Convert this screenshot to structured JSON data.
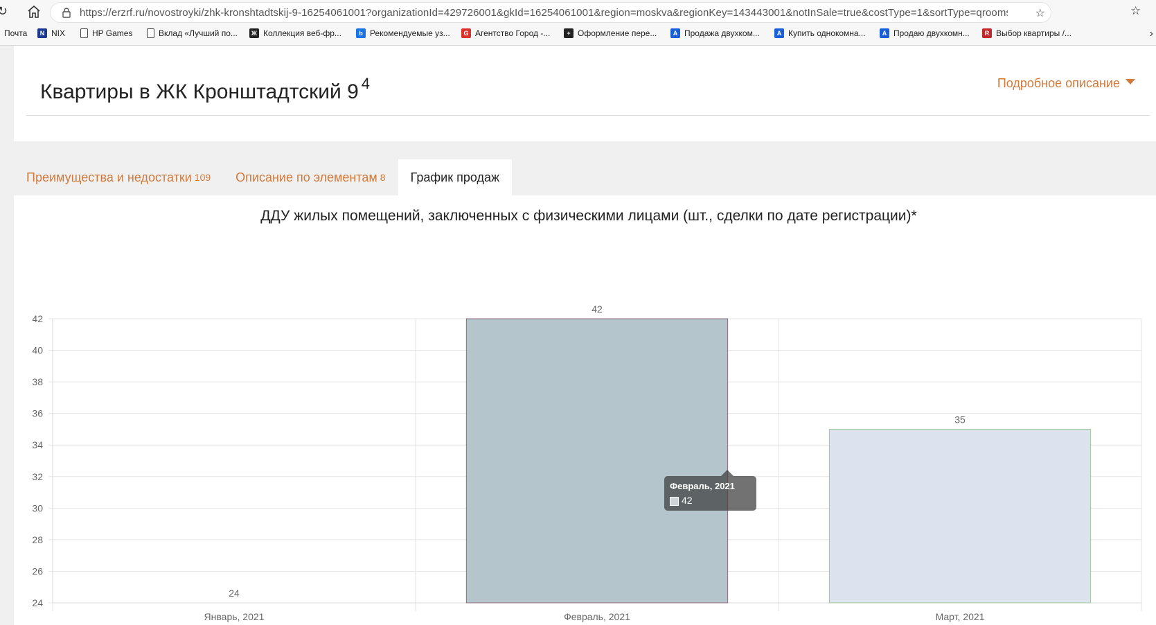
{
  "browser": {
    "url": "https://erzrf.ru/novostroyki/zhk-kronshtadtskij-9-16254061001?organizationId=429726001&gkId=16254061001&region=moskva&regionKey=143443001&notInSale=true&costType=1&sortType=qrooms...",
    "bookmarks": [
      {
        "label": "Почта",
        "icon": "none",
        "color": ""
      },
      {
        "label": "NIX",
        "icon": "nix-icon",
        "color": "#1b3b8f"
      },
      {
        "label": "HP Games",
        "icon": "page-icon",
        "color": ""
      },
      {
        "label": "Вклад «Лучший по...",
        "icon": "page-icon",
        "color": ""
      },
      {
        "label": "Коллекция веб-фр...",
        "icon": "collection-icon",
        "color": "#222"
      },
      {
        "label": "Рекомендуемые уз...",
        "icon": "bing-icon",
        "color": "#1a73e8"
      },
      {
        "label": "Агентство Город -...",
        "icon": "g-icon",
        "color": "#d9332b"
      },
      {
        "label": "Оформление пере...",
        "icon": "plus-icon",
        "color": "#222"
      },
      {
        "label": "Продажа двухком...",
        "icon": "a-icon",
        "color": "#1a5fd6"
      },
      {
        "label": "Купить однокомна...",
        "icon": "a-icon",
        "color": "#1a5fd6"
      },
      {
        "label": "Продаю двухкомн...",
        "icon": "a-icon",
        "color": "#1a5fd6"
      },
      {
        "label": "Выбор квартиры /...",
        "icon": "rg-icon",
        "color": "#c0282c"
      }
    ]
  },
  "header": {
    "title": "Квартиры в ЖК Кронштадтский 9",
    "title_count": "4",
    "details_label": "Подробное описание"
  },
  "tabs": [
    {
      "label": "Преимущества и недостатки",
      "count": "109",
      "active": false
    },
    {
      "label": "Описание по элементам",
      "count": "8",
      "active": false
    },
    {
      "label": "График продаж",
      "count": "",
      "active": true
    }
  ],
  "chart_data": {
    "type": "bar",
    "title": "ДДУ жилых помещений, заключенных с физическими лицами (шт., сделки по дате регистрации)*",
    "categories": [
      "Январь, 2021",
      "Февраль, 2021",
      "Март, 2021"
    ],
    "values": [
      24,
      42,
      35
    ],
    "bar_colors": [
      "#b4c6cb",
      "#b4c6cb",
      "#dde2ef"
    ],
    "bar_border_colors": [
      "#8b6b78",
      "#8b6b78",
      "#9fc79a"
    ],
    "ylim": [
      24,
      42
    ],
    "yticks": [
      24,
      26,
      28,
      30,
      32,
      34,
      36,
      38,
      40,
      42
    ],
    "grid": true,
    "xlabel": "",
    "ylabel": ""
  },
  "tooltip": {
    "title": "Февраль, 2021",
    "value": "42"
  }
}
